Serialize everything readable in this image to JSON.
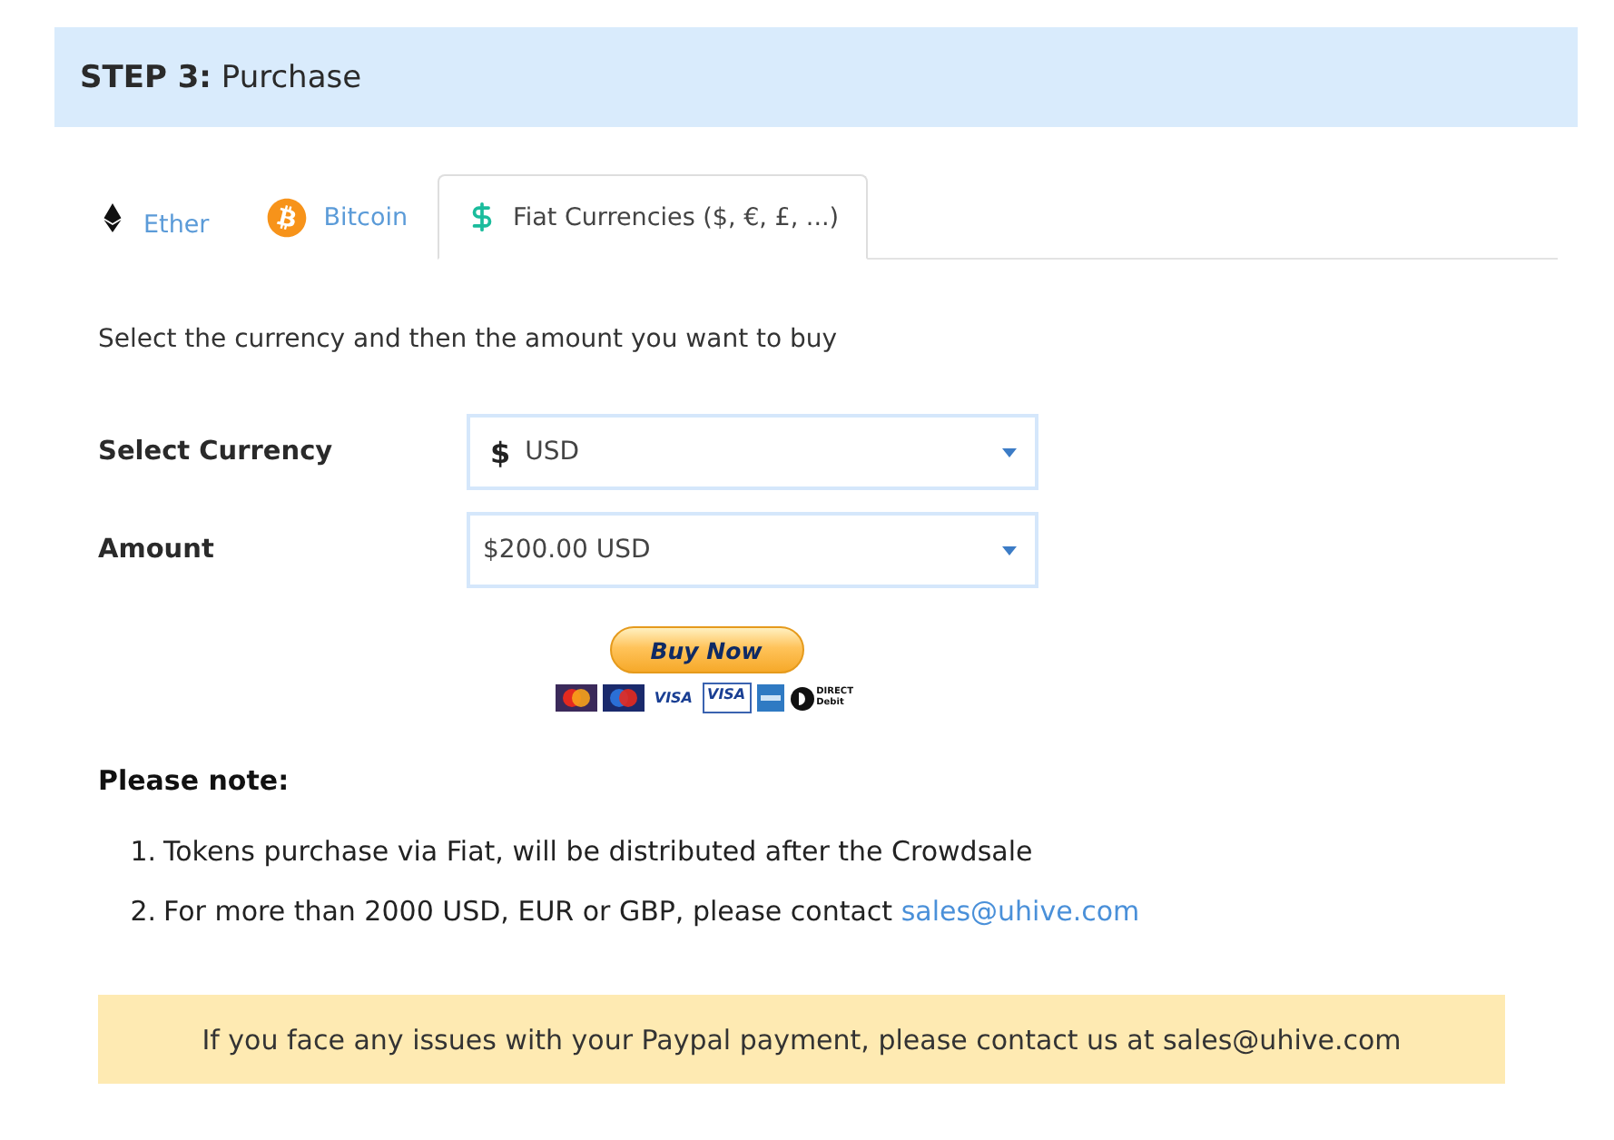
{
  "header": {
    "title": "**STEP 3:** Purchase"
  },
  "tabs": [
    {
      "label": "Ether",
      "kind": "ether",
      "selected": false
    },
    {
      "label": "Bitcoin",
      "kind": "bitcoin",
      "selected": false
    },
    {
      "label": "Fiat Currencies ($, €, £, ...)",
      "kind": "fiat",
      "selected": true
    }
  ],
  "instruction": "Select the currency and then the amount you want to buy",
  "form": [
    {
      "label": "Select Currency",
      "symbol": "$",
      "value": "USD"
    },
    {
      "label": "Amount",
      "value": "$200.00 USD"
    }
  ],
  "buy_button": {
    "label": "Buy Now"
  },
  "cards": [
    {
      "kind": "mastercard"
    },
    {
      "kind": "maestro"
    },
    {
      "kind": "visa",
      "label": "VISA"
    },
    {
      "kind": "visa_electron",
      "label": "VISA"
    },
    {
      "kind": "amex"
    },
    {
      "kind": "direct_debit",
      "label": "DIRECT Debit"
    }
  ],
  "note": {
    "title": "Please note:",
    "items": [
      {
        "number": "1.",
        "text": "Tokens purchase via Fiat, will be distributed after the Crowdsale"
      },
      {
        "number": "2.",
        "text": "For more than 2000 USD, EUR or GBP, please contact",
        "link": "sales@uhive.com"
      }
    ]
  },
  "alert": {
    "text": "If you face any issues with your Paypal payment, please contact us at sales@uhive.com"
  }
}
